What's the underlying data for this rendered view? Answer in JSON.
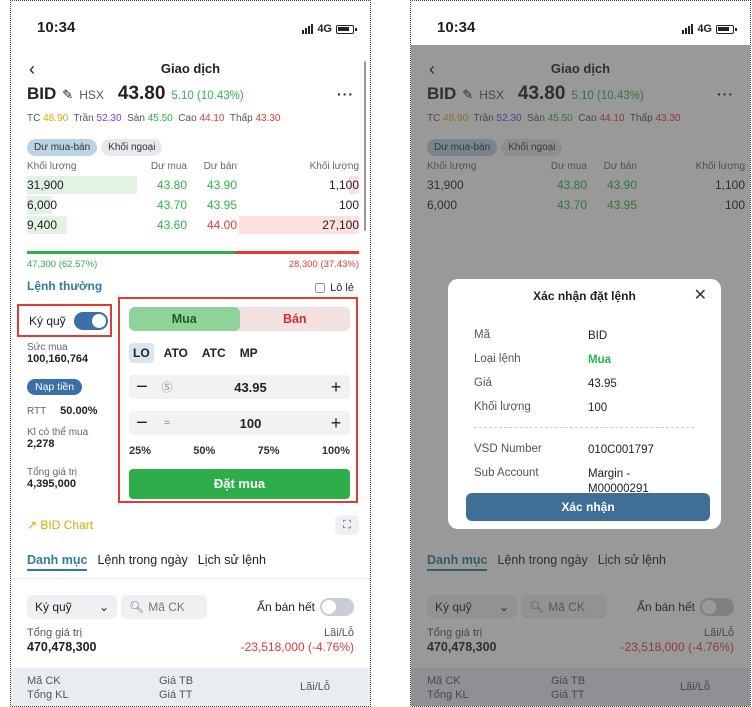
{
  "status": {
    "time": "10:34",
    "network": "4G"
  },
  "header": {
    "title": "Giao dịch",
    "symbol": "BID",
    "exchange": "HSX",
    "price": "43.80",
    "change": "5.10 (10.43%)"
  },
  "refs": {
    "tc_label": "TC",
    "tc": "48.90",
    "tran_label": "Trần",
    "tran": "52.30",
    "san_label": "Sàn",
    "san": "45.50",
    "cao_label": "Cao",
    "cao": "44.10",
    "thap_label": "Thấp",
    "thap": "43.30"
  },
  "book_tabs": [
    "Dư mua-bán",
    "Khối ngoại"
  ],
  "book": {
    "headers": [
      "Khối lượng",
      "Dư mua",
      "Dư bán",
      "Khối lượng"
    ],
    "rows": [
      {
        "vol_buy": "31,900",
        "bid": "43.80",
        "ask": "43.90",
        "vol_sell": "1,100"
      },
      {
        "vol_buy": "6,000",
        "bid": "43.70",
        "ask": "43.95",
        "vol_sell": "100"
      },
      {
        "vol_buy": "9,400",
        "bid": "43.60",
        "ask": "44.00",
        "vol_sell": "27,100"
      }
    ],
    "buy_total": "47,300 (62.57%)",
    "sell_total": "28,300 (37.43%)",
    "buy_ratio": 0.6257
  },
  "order_type_label": "Lệnh thường",
  "lot_label": "Lô lẻ",
  "margin_label": "Ký quỹ",
  "account": {
    "buying_power_label": "Sức mua",
    "buying_power": "100,160,764",
    "deposit_label": "Nạp tiền",
    "rtt_label": "RTT",
    "rtt": "50.00%",
    "max_buy_label": "Kl có thể mua",
    "max_buy": "2,278",
    "total_label": "Tổng giá trị",
    "total": "4,395,000"
  },
  "order": {
    "buy_label": "Mua",
    "sell_label": "Bán",
    "types": [
      "LO",
      "ATO",
      "ATC",
      "MP"
    ],
    "price": "43.95",
    "quantity": "100",
    "percents": [
      "25%",
      "50%",
      "75%",
      "100%"
    ],
    "submit_label": "Đặt mua"
  },
  "chart_label": "BID Chart",
  "portfolio_tabs": [
    "Danh mục",
    "Lệnh trong ngày",
    "Lịch sử lệnh"
  ],
  "portfolio": {
    "filter": "Ký quỹ",
    "search_placeholder": "Mã CK",
    "hide_sold_label": "Ẩn bán hết",
    "total_label": "Tổng giá trị",
    "total": "470,478,300",
    "pnl_label": "Lãi/Lỗ",
    "pnl": "-23,518,000 (-4.76%)",
    "col_code": "Mã CK",
    "col_vol": "Tổng KL",
    "col_avg": "Giá TB",
    "col_mkt": "Giá TT",
    "col_pnl": "Lãi/Lỗ"
  },
  "modal": {
    "title": "Xác nhận đặt lệnh",
    "code_label": "Mã",
    "code": "BID",
    "type_label": "Loại lệnh",
    "type": "Mua",
    "price_label": "Giá",
    "price": "43.95",
    "qty_label": "Khối lượng",
    "qty": "100",
    "vsd_label": "VSD Number",
    "vsd": "010C001797",
    "sub_label": "Sub Account",
    "sub": "Margin - M00000291",
    "confirm_label": "Xác nhận"
  }
}
